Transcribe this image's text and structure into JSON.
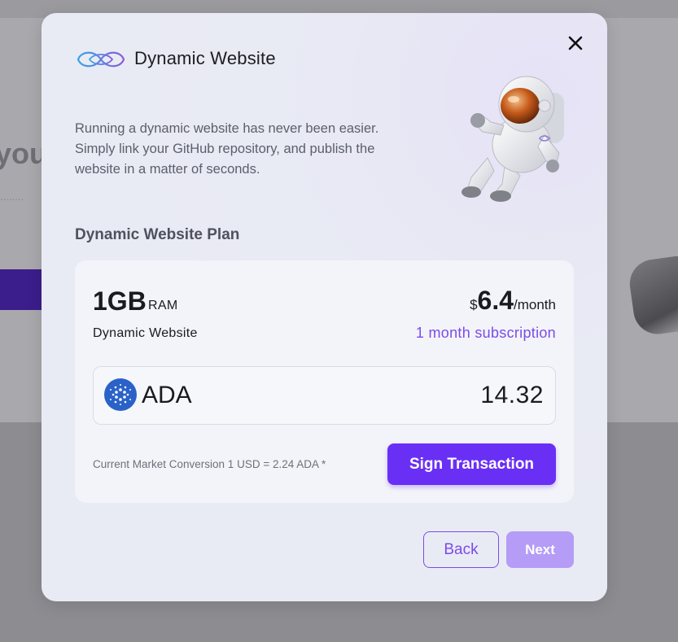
{
  "modal": {
    "title": "Dynamic Website",
    "description": "Running a dynamic website has never been easier. Simply link your GitHub repository, and publish the website in a matter of seconds.",
    "plan_title": "Dynamic Website Plan",
    "close_icon": "close-icon",
    "logo_icon": "infinity-logo-icon",
    "illustration": "astronaut-illustration"
  },
  "plan": {
    "ram_size": "1GB",
    "ram_unit": "RAM",
    "name": "Dynamic Website",
    "currency_symbol": "$",
    "price": "6.4",
    "period": "/month",
    "subscription": "1 month subscription"
  },
  "payment": {
    "token_icon": "cardano-icon",
    "token": "ADA",
    "amount": "14.32",
    "conversion": "Current Market Conversion 1 USD = 2.24 ADA *",
    "sign_label": "Sign Transaction"
  },
  "footer": {
    "back_label": "Back",
    "next_label": "Next"
  },
  "colors": {
    "accent": "#6a2ff5",
    "accent_text": "#7b4bea",
    "next_disabled": "#b59cf7",
    "overlay": "#8e8d92"
  }
}
